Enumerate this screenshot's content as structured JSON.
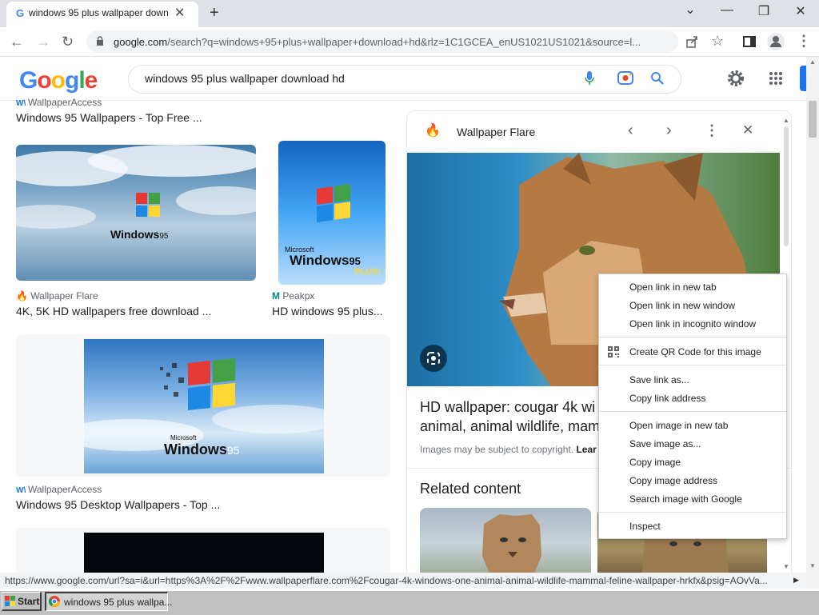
{
  "browser": {
    "tab_title": "windows 95 plus wallpaper down",
    "tab_close": "✕",
    "new_tab": "+",
    "url_host": "google.com",
    "url_path": "/search?q=windows+95+plus+wallpaper+download+hd&rlz=1C1GCEA_enUS1021US1021&source=l...",
    "window_min": "—",
    "window_restore": "❐",
    "window_close": "✕",
    "tabs_menu": "⌄"
  },
  "google": {
    "logo": "Google",
    "query": "windows 95 plus wallpaper download hd"
  },
  "results": [
    {
      "source": "WallpaperAccess",
      "title": "Windows 95 Wallpapers - Top Free ..."
    },
    {
      "source": "Wallpaper Flare",
      "title": "4K, 5K HD wallpapers free download ..."
    },
    {
      "source": "Peakpx",
      "title": "HD windows 95 plus..."
    },
    {
      "source": "WallpaperAccess",
      "title": "Windows 95 Desktop Wallpapers - Top ..."
    }
  ],
  "thumb_text": {
    "win1": "Windows",
    "num1": "95",
    "ms": "Microsoft",
    "win2": "Windows",
    "num2": "95",
    "plus": "PLUS!",
    "ms3": "Microsoft",
    "win3": "Windows",
    "num3": "95"
  },
  "panel": {
    "source": "Wallpaper Flare",
    "title_line1": "HD wallpaper: cougar 4k wi",
    "title_line2": "animal, animal wildlife, mam",
    "copyright": "Images may be subject to copyright.",
    "learn": "Lear",
    "related": "Related content"
  },
  "context_menu": [
    "Open link in new tab",
    "Open link in new window",
    "Open link in incognito window",
    "Create QR Code for this image",
    "Save link as...",
    "Copy link address",
    "Open image in new tab",
    "Save image as...",
    "Copy image",
    "Copy image address",
    "Search image with Google",
    "Inspect"
  ],
  "status_url": "https://www.google.com/url?sa=i&url=https%3A%2F%2Fwww.wallpaperflare.com%2Fcougar-4k-windows-one-animal-animal-wildlife-mammal-feline-wallpaper-hrkfx&psig=AOvVa...",
  "taskbar": {
    "start": "Start",
    "task_item": "windows 95 plus wallpa..."
  },
  "colors": {
    "accent": "#1a73e8",
    "win_red": "#e53935",
    "win_green": "#43a047",
    "win_blue": "#1e88e5",
    "win_yellow": "#fdd835"
  }
}
